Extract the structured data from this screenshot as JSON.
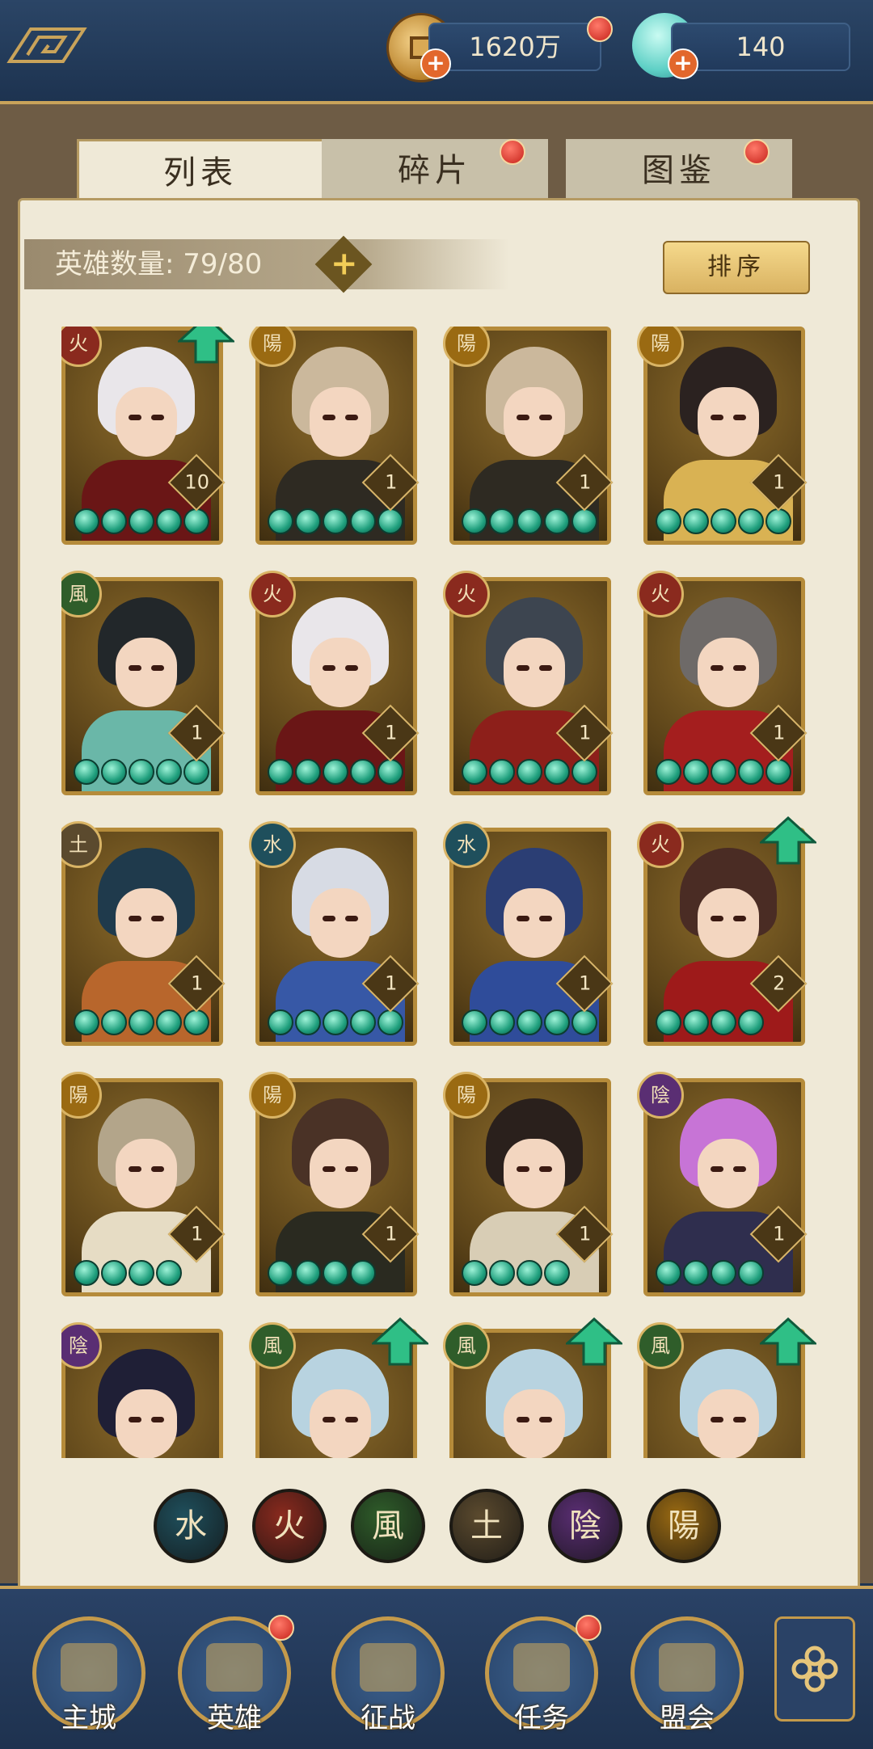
{
  "resources": {
    "coins": "1620万",
    "gems": "140"
  },
  "tabs": [
    {
      "label": "列表",
      "active": true
    },
    {
      "label": "碎片",
      "active": false
    },
    {
      "label": "图鉴",
      "active": false
    }
  ],
  "hero_count": {
    "label": "英雄数量:",
    "value": "79/80"
  },
  "sort_label": "排序",
  "element_colors": {
    "火": "#8a2a1e",
    "陽": "#9a6a12",
    "風": "#2f5d2a",
    "土": "#5b4a2e",
    "水": "#1f4f5c",
    "陰": "#5a2e73"
  },
  "heroes": [
    {
      "element": "火",
      "level": "10",
      "stars": 5,
      "hair": "#e9e6ea",
      "outfit": "#6a1616",
      "upgrade": true
    },
    {
      "element": "陽",
      "level": "1",
      "stars": 5,
      "hair": "#cbb89c",
      "outfit": "#2e2a22",
      "upgrade": false
    },
    {
      "element": "陽",
      "level": "1",
      "stars": 5,
      "hair": "#cbb89c",
      "outfit": "#2e2a22",
      "upgrade": false
    },
    {
      "element": "陽",
      "level": "1",
      "stars": 5,
      "hair": "#2b2220",
      "outfit": "#d9b253",
      "upgrade": false
    },
    {
      "element": "風",
      "level": "1",
      "stars": 5,
      "hair": "#22272a",
      "outfit": "#6ab7a8",
      "upgrade": false
    },
    {
      "element": "火",
      "level": "1",
      "stars": 5,
      "hair": "#e9e6ea",
      "outfit": "#6a1616",
      "upgrade": false
    },
    {
      "element": "火",
      "level": "1",
      "stars": 5,
      "hair": "#3d4550",
      "outfit": "#8d1f1a",
      "upgrade": false
    },
    {
      "element": "火",
      "level": "1",
      "stars": 5,
      "hair": "#6e6a68",
      "outfit": "#a41e1e",
      "upgrade": false
    },
    {
      "element": "土",
      "level": "1",
      "stars": 5,
      "hair": "#1f3a4c",
      "outfit": "#b8662c",
      "upgrade": false
    },
    {
      "element": "水",
      "level": "1",
      "stars": 5,
      "hair": "#d7dbe4",
      "outfit": "#3758a6",
      "upgrade": false
    },
    {
      "element": "水",
      "level": "1",
      "stars": 5,
      "hair": "#2b3e74",
      "outfit": "#2f4c9a",
      "upgrade": false
    },
    {
      "element": "火",
      "level": "2",
      "stars": 4,
      "hair": "#4a2c24",
      "outfit": "#9e1a1a",
      "upgrade": true
    },
    {
      "element": "陽",
      "level": "1",
      "stars": 4,
      "hair": "#b3a58a",
      "outfit": "#e6dcc4",
      "upgrade": false
    },
    {
      "element": "陽",
      "level": "1",
      "stars": 4,
      "hair": "#4a3226",
      "outfit": "#2a2a20",
      "upgrade": false
    },
    {
      "element": "陽",
      "level": "1",
      "stars": 4,
      "hair": "#2a201c",
      "outfit": "#d8cdb5",
      "upgrade": false
    },
    {
      "element": "陰",
      "level": "1",
      "stars": 4,
      "hair": "#c774d6",
      "outfit": "#2f2e4e",
      "upgrade": false
    },
    {
      "element": "陰",
      "level": "",
      "stars": 0,
      "hair": "#1f1f36",
      "outfit": "#4a3668",
      "upgrade": false
    },
    {
      "element": "風",
      "level": "",
      "stars": 0,
      "hair": "#b8d3e0",
      "outfit": "#5f8a3a",
      "upgrade": true
    },
    {
      "element": "風",
      "level": "",
      "stars": 0,
      "hair": "#b8d3e0",
      "outfit": "#5f8a3a",
      "upgrade": true
    },
    {
      "element": "風",
      "level": "",
      "stars": 0,
      "hair": "#b8d3e0",
      "outfit": "#5f8a3a",
      "upgrade": true
    }
  ],
  "element_filters": [
    "水",
    "火",
    "風",
    "土",
    "陰",
    "陽"
  ],
  "nav": [
    {
      "label": "主城",
      "badge": false
    },
    {
      "label": "英雄",
      "badge": true
    },
    {
      "label": "征战",
      "badge": false
    },
    {
      "label": "任务",
      "badge": true
    },
    {
      "label": "盟会",
      "badge": false
    }
  ]
}
